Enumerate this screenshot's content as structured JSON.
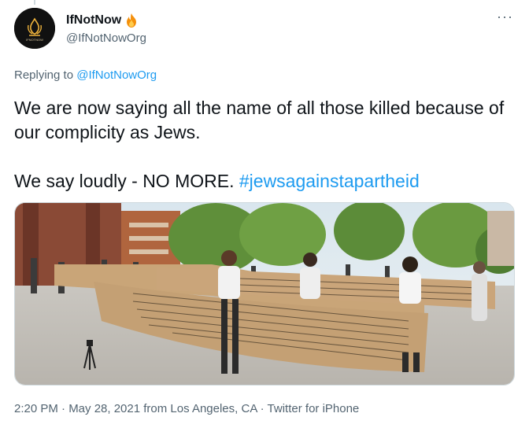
{
  "tweet": {
    "display_name": "IfNotNow",
    "handle": "@IfNotNowOrg",
    "avatar_text": "IFNOTNOW",
    "more_label": "···",
    "replying_prefix": "Replying to ",
    "replying_handle": "@IfNotNowOrg",
    "text_line1": "We are now saying all the name of all those killed because of our complicity as Jews.",
    "text_line2_prefix": "We say loudly - NO MORE. ",
    "hashtag": "#jewsagainstapartheid",
    "meta": "2:20 PM · May 28, 2021 from Los Angeles, CA · Twitter for iPhone"
  },
  "colors": {
    "link": "#1d9bf0",
    "secondary": "#536471",
    "primary_text": "#0f1419"
  },
  "icons": {
    "fire": "fire-icon",
    "more": "more-icon",
    "avatar_logo": "flame-logo-icon"
  }
}
